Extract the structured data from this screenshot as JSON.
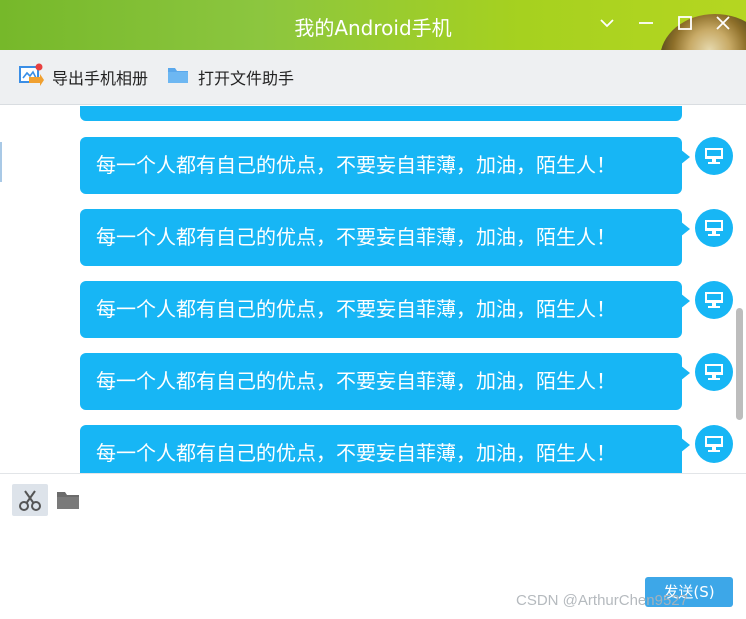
{
  "window": {
    "title": "我的Android手机",
    "controls": [
      "chevron-down-icon",
      "minimize-icon",
      "maximize-icon",
      "close-icon"
    ]
  },
  "toolbar": {
    "export_label": "导出手机相册",
    "open_folder_label": "打开文件助手"
  },
  "chat": {
    "messages": [
      {
        "text": "每一个人都有自己的优点，不要妄自菲薄，加油，陌生人！"
      },
      {
        "text": "每一个人都有自己的优点，不要妄自菲薄，加油，陌生人！"
      },
      {
        "text": "每一个人都有自己的优点，不要妄自菲薄，加油，陌生人！"
      },
      {
        "text": "每一个人都有自己的优点，不要妄自菲薄，加油，陌生人！"
      },
      {
        "text": "每一个人都有自己的优点，不要妄自菲薄，加油，陌生人！"
      }
    ],
    "bubble_color": "#17b6f5",
    "avatar_icon": "monitor-icon"
  },
  "input": {
    "tools": [
      "scissors-icon",
      "folder-icon"
    ],
    "send_label": "发送(S)"
  },
  "watermark": "CSDN @ArthurChen9527",
  "colors": {
    "titlebar_accent": "#8cc63f",
    "bubble": "#17b6f5",
    "send_button": "#3da7e8"
  }
}
